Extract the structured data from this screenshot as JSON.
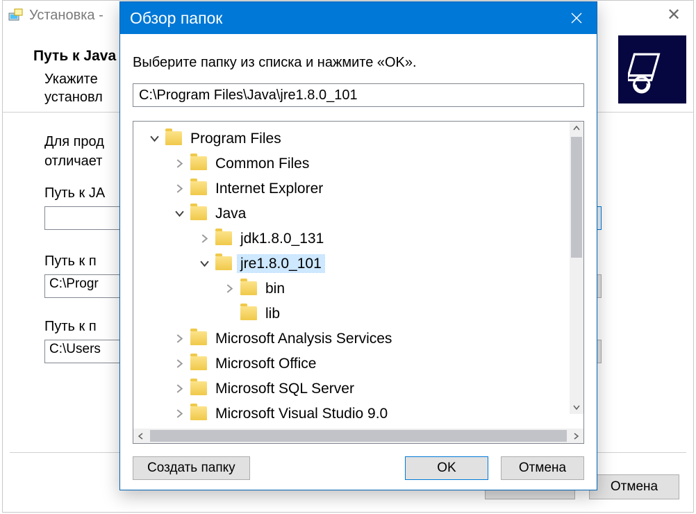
{
  "bg": {
    "title": "Установка -",
    "heading": "Путь к Java",
    "sub_line1": "Укажите",
    "sub_line2": "установл",
    "body_line1": "Для прод",
    "body_line2": "отличает",
    "label_java": "Путь к JA",
    "input_java": "",
    "label_path2": "Путь к п",
    "input_path2": "C:\\Progr",
    "label_path3": "Путь к п",
    "input_path3": "C:\\Users",
    "browse": "...",
    "cancel": "Отмена"
  },
  "dlg": {
    "title": "Обзор папок",
    "prompt": "Выберите папку из списка и нажмите «OK».",
    "path": "C:\\Program Files\\Java\\jre1.8.0_101",
    "btn_new_folder": "Создать папку",
    "btn_ok": "OK",
    "btn_cancel": "Отмена"
  },
  "tree": {
    "n0": "Program Files",
    "n1": "Common Files",
    "n2": "Internet Explorer",
    "n3": "Java",
    "n4": "jdk1.8.0_131",
    "n5": "jre1.8.0_101",
    "n6": "bin",
    "n7": "lib",
    "n8": "Microsoft Analysis Services",
    "n9": "Microsoft Office",
    "n10": "Microsoft SQL Server",
    "n11": "Microsoft Visual Studio 9.0"
  }
}
